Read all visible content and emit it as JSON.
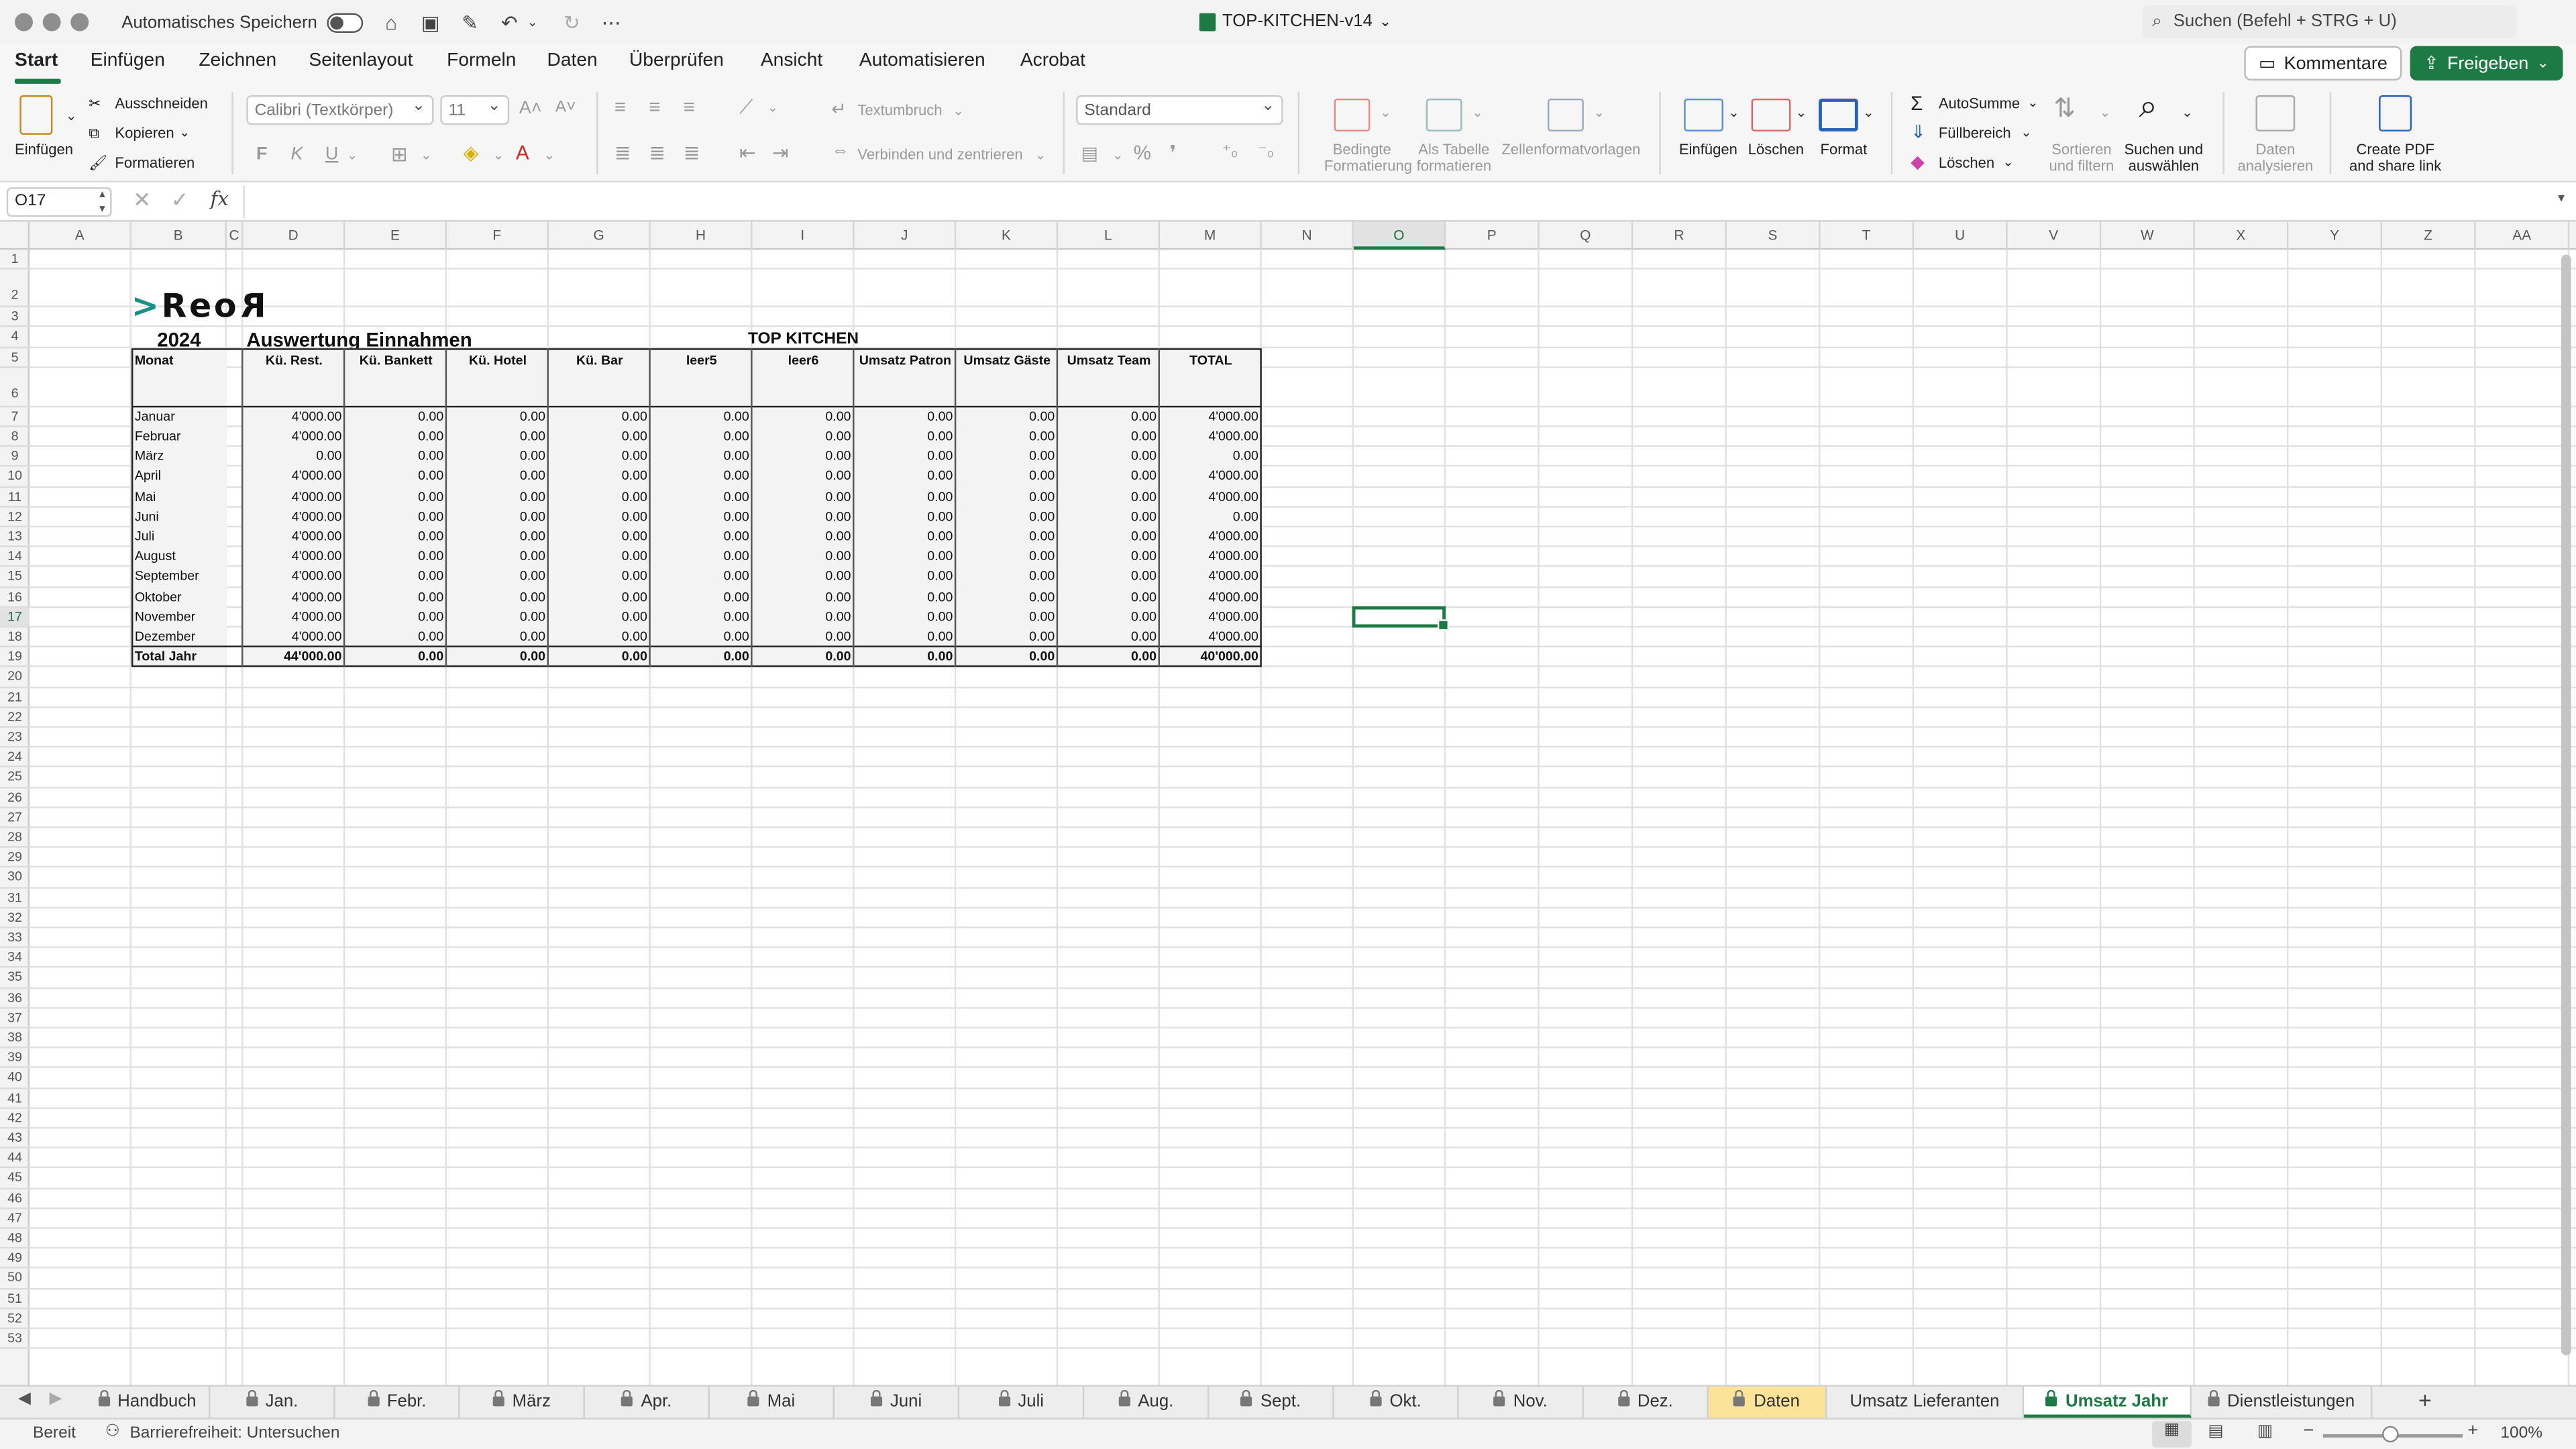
{
  "window": {
    "autosave_label": "Automatisches Speichern",
    "file_title": "TOP-KITCHEN-v14",
    "search_placeholder": "Suchen (Befehl + STRG + U)"
  },
  "menu": {
    "items": [
      "Start",
      "Einfügen",
      "Zeichnen",
      "Seitenlayout",
      "Formeln",
      "Daten",
      "Überprüfen",
      "Ansicht",
      "Automatisieren",
      "Acrobat"
    ],
    "comments_label": "Kommentare",
    "share_label": "Freigeben"
  },
  "ribbon": {
    "paste": "Einfügen",
    "cut": "Ausschneiden",
    "copy": "Kopieren",
    "format_painter": "Formatieren",
    "font_name": "Calibri (Textkörper)",
    "font_size": "11",
    "bold": "F",
    "italic": "K",
    "underline": "U",
    "wrap_text": "Textumbruch",
    "merge_center": "Verbinden und zentrieren",
    "number_format": "Standard",
    "conditional_format": "Bedingte Formatierung",
    "as_table": "Als Tabelle formatieren",
    "cell_styles": "Zellenformatvorlagen",
    "insert_cells": "Einfügen",
    "delete_cells": "Löschen",
    "format_cells": "Format",
    "autosum": "AutoSumme",
    "fill": "Füllbereich",
    "clear": "Löschen",
    "sort_filter": "Sortieren und filtern",
    "find_select": "Suchen und auswählen",
    "analyze_data": "Daten analysieren",
    "create_pdf": "Create PDF and share link"
  },
  "formula_bar": {
    "name_box": "O17",
    "fx": "fx",
    "content": ""
  },
  "colors": {
    "accent": "#1d7a45",
    "logo_arrow": "#1a8f86",
    "daten_tab": "#fbe49a"
  },
  "columns": [
    "A",
    "B",
    "C",
    "D",
    "E",
    "F",
    "G",
    "H",
    "I",
    "J",
    "K",
    "L",
    "M",
    "N",
    "O",
    "P",
    "Q",
    "R",
    "S",
    "T",
    "U",
    "V",
    "W",
    "X",
    "Y",
    "Z",
    "AA"
  ],
  "selected_column": "O",
  "selected_row": "17",
  "sheet": {
    "logo_text": "Reo",
    "logo_mirror": "R",
    "logo_prefix": ">",
    "year": "2024",
    "title": "Auswertung Einnahmen",
    "company": "TOP KITCHEN",
    "headers": [
      "Monat",
      "Kü. Rest.",
      "Kü. Bankett",
      "Kü. Hotel",
      "Kü. Bar",
      "leer5",
      "leer6",
      "Umsatz Patron",
      "Umsatz Gäste",
      "Umsatz Team",
      "TOTAL"
    ],
    "rows": [
      [
        "Januar",
        "4'000.00",
        "0.00",
        "0.00",
        "0.00",
        "0.00",
        "0.00",
        "0.00",
        "0.00",
        "0.00",
        "4'000.00"
      ],
      [
        "Februar",
        "4'000.00",
        "0.00",
        "0.00",
        "0.00",
        "0.00",
        "0.00",
        "0.00",
        "0.00",
        "0.00",
        "4'000.00"
      ],
      [
        "März",
        "0.00",
        "0.00",
        "0.00",
        "0.00",
        "0.00",
        "0.00",
        "0.00",
        "0.00",
        "0.00",
        "0.00"
      ],
      [
        "April",
        "4'000.00",
        "0.00",
        "0.00",
        "0.00",
        "0.00",
        "0.00",
        "0.00",
        "0.00",
        "0.00",
        "4'000.00"
      ],
      [
        "Mai",
        "4'000.00",
        "0.00",
        "0.00",
        "0.00",
        "0.00",
        "0.00",
        "0.00",
        "0.00",
        "0.00",
        "4'000.00"
      ],
      [
        "Juni",
        "4'000.00",
        "0.00",
        "0.00",
        "0.00",
        "0.00",
        "0.00",
        "0.00",
        "0.00",
        "0.00",
        "0.00"
      ],
      [
        "Juli",
        "4'000.00",
        "0.00",
        "0.00",
        "0.00",
        "0.00",
        "0.00",
        "0.00",
        "0.00",
        "0.00",
        "4'000.00"
      ],
      [
        "August",
        "4'000.00",
        "0.00",
        "0.00",
        "0.00",
        "0.00",
        "0.00",
        "0.00",
        "0.00",
        "0.00",
        "4'000.00"
      ],
      [
        "September",
        "4'000.00",
        "0.00",
        "0.00",
        "0.00",
        "0.00",
        "0.00",
        "0.00",
        "0.00",
        "0.00",
        "4'000.00"
      ],
      [
        "Oktober",
        "4'000.00",
        "0.00",
        "0.00",
        "0.00",
        "0.00",
        "0.00",
        "0.00",
        "0.00",
        "0.00",
        "4'000.00"
      ],
      [
        "November",
        "4'000.00",
        "0.00",
        "0.00",
        "0.00",
        "0.00",
        "0.00",
        "0.00",
        "0.00",
        "0.00",
        "4'000.00"
      ],
      [
        "Dezember",
        "4'000.00",
        "0.00",
        "0.00",
        "0.00",
        "0.00",
        "0.00",
        "0.00",
        "0.00",
        "0.00",
        "4'000.00"
      ]
    ],
    "total_row": [
      "Total Jahr",
      "44'000.00",
      "0.00",
      "0.00",
      "0.00",
      "0.00",
      "0.00",
      "0.00",
      "0.00",
      "0.00",
      "40'000.00"
    ]
  },
  "tabs": [
    {
      "label": "Handbuch",
      "locked": true
    },
    {
      "label": "Jan.",
      "locked": true
    },
    {
      "label": "Febr.",
      "locked": true
    },
    {
      "label": "März",
      "locked": true
    },
    {
      "label": "Apr.",
      "locked": true
    },
    {
      "label": "Mai",
      "locked": true
    },
    {
      "label": "Juni",
      "locked": true
    },
    {
      "label": "Juli",
      "locked": true
    },
    {
      "label": "Aug.",
      "locked": true
    },
    {
      "label": "Sept.",
      "locked": true
    },
    {
      "label": "Okt.",
      "locked": true
    },
    {
      "label": "Nov.",
      "locked": true
    },
    {
      "label": "Dez.",
      "locked": true
    },
    {
      "label": "Daten",
      "locked": true
    },
    {
      "label": "Umsatz Lieferanten",
      "locked": false
    },
    {
      "label": "Umsatz Jahr",
      "locked": true
    },
    {
      "label": "Dienstleistungen",
      "locked": true
    }
  ],
  "add_sheet": "+",
  "status": {
    "ready": "Bereit",
    "accessibility": "Barrierefreiheit: Untersuchen",
    "zoom": "100%"
  }
}
